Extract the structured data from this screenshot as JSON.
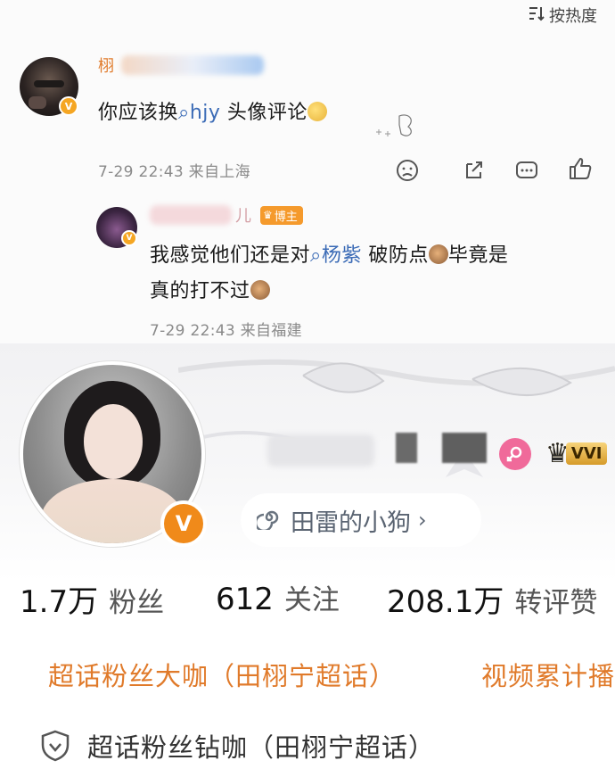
{
  "sort_label": "按热度",
  "comment1": {
    "name": "栩",
    "text_before": "你应该换",
    "search_tag": "hjy",
    "text_after": " 头像评论",
    "meta": "7-29 22:43 来自上海"
  },
  "reply1": {
    "name_suffix": "儿",
    "badge": "博主",
    "line1_before": "我感觉他们还是对",
    "search_tag": "杨紫",
    "line1_after": " 破防点",
    "line1_end": "毕竟是",
    "line2": "真的打不过",
    "meta": "7-29 22:43 来自福建"
  },
  "profile": {
    "vip_label": "VVI",
    "verify_mark": "V",
    "topic_pill": "田雷的小狗",
    "stats": [
      {
        "value": "1.7万",
        "label": "粉丝"
      },
      {
        "value": "612",
        "label": "关注"
      },
      {
        "value": "208.1万",
        "label": "转评赞"
      }
    ],
    "tag_orange_1": "超话粉丝大咖（田栩宁超话）",
    "tag_orange_2": "视频累计播",
    "tag_gray": "超话粉丝钻咖（田栩宁超话）"
  },
  "colors": {
    "link_blue": "#3b6bb6",
    "orange": "#e07a2a",
    "badge_gold": "#f5a623"
  }
}
